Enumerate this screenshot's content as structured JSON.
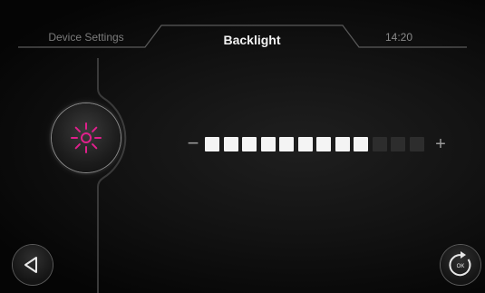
{
  "header": {
    "left_tab": "Device Settings",
    "active_tab": "Backlight",
    "time": "14:20"
  },
  "backlight": {
    "icon": "sun-icon",
    "level": 9,
    "max_level": 12,
    "minus_label": "−",
    "plus_label": "+"
  },
  "footer": {
    "back_icon": "back-triangle-icon",
    "ok_label": "OK",
    "ok_icon": "refresh-ok-icon"
  },
  "colors": {
    "accent": "#e0208c",
    "segment_on": "#f4f4f4",
    "segment_off": "#2d2d2d"
  }
}
